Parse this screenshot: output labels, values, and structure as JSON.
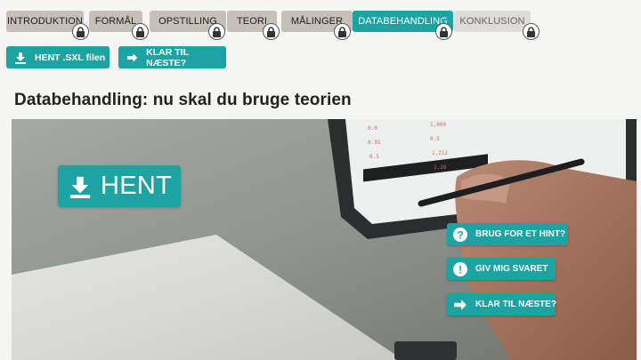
{
  "tabs": [
    {
      "label": "INTRODUKTION",
      "state": "done"
    },
    {
      "label": "FORMÅL",
      "state": "done"
    },
    {
      "label": "OPSTILLING",
      "state": "done"
    },
    {
      "label": "TEORI",
      "state": "done"
    },
    {
      "label": "MÅLINGER",
      "state": "done"
    },
    {
      "label": "DATABEHANDLING",
      "state": "active"
    },
    {
      "label": "KONKLUSION",
      "state": "disabled"
    }
  ],
  "actions": {
    "download_label": "HENT .SXL filen",
    "next_label": "KLAR TIL NÆSTE?"
  },
  "page": {
    "title": "Databehandling: nu skal du bruge teorien"
  },
  "video": {
    "hent_label": "HENT",
    "hint_label": "BRUG FOR ET HINT?",
    "answer_label": "GIV MIG SVARET",
    "next_label": "KLAR TIL NÆSTE?",
    "tablet_values": [
      "0.0",
      "1,000",
      "0.95",
      "0.5",
      "1,212",
      "1,26",
      "0.5"
    ]
  },
  "colors": {
    "accent": "#1ea3a3",
    "tab_done": "#c6c0b8",
    "tab_disabled": "#dedcd9",
    "background": "#f5f5f3"
  },
  "icons": [
    "lock-icon",
    "download-icon",
    "arrow-right-icon",
    "question-icon",
    "exclamation-icon"
  ]
}
